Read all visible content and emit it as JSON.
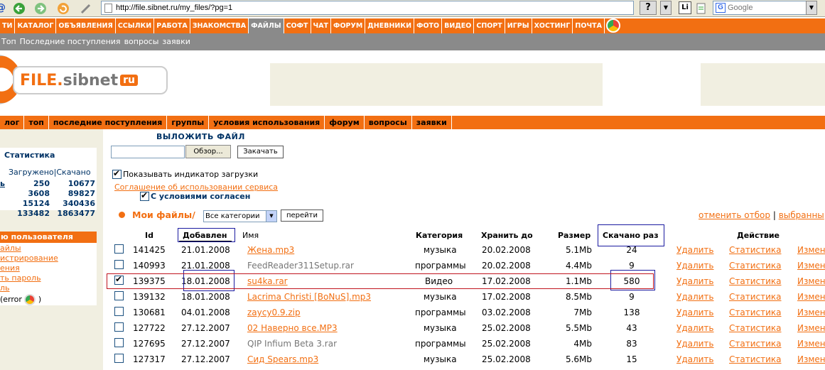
{
  "browser": {
    "url": "http://file.sibnet.ru/my_files/?pg=1",
    "help_label": "?",
    "search_placeholder": "Google",
    "li_label": "Li"
  },
  "top_nav": [
    "ТИ",
    "КАТАЛОГ",
    "ОБЪЯВЛЕНИЯ",
    "ССЫЛКИ",
    "РАБОТА",
    "ЗНАКОМСТВА",
    "ФАЙЛЫ",
    "СОФТ",
    "ЧАТ",
    "ФОРУМ",
    "ДНЕВНИКИ",
    "ФОТО",
    "ВИДЕО",
    "СПОРТ",
    "ИГРЫ",
    "ХОСТИНГ",
    "ПОЧТА"
  ],
  "top_nav_active": "ФАЙЛЫ",
  "sub_nav": [
    "Топ",
    "Последние поступления",
    "вопросы",
    "заявки"
  ],
  "logo": {
    "main": "FILE.",
    "brand": "sibnet",
    "tld": "ru"
  },
  "sec_nav": [
    "лог",
    "топ",
    "последние поступления",
    "группы",
    "условия использования",
    "форум",
    "вопросы",
    "заявки"
  ],
  "sidebar": {
    "stats_title": "Статистика",
    "stats_header": "Загружено|Скачано",
    "stats_rows": [
      {
        "prefix": "ь",
        "uploaded": "250",
        "downloaded": "10677"
      },
      {
        "prefix": "",
        "uploaded": "3608",
        "downloaded": "89827"
      },
      {
        "prefix": "",
        "uploaded": "15124",
        "downloaded": "340436"
      },
      {
        "prefix": "",
        "uploaded": "133482",
        "downloaded": "1863477"
      }
    ],
    "user_menu_title": "ю пользователя",
    "user_links": [
      "айлы",
      "истрирование",
      "ения",
      "ть пароль",
      "ль"
    ],
    "error_label": "(error",
    "error_suffix": ")"
  },
  "upload": {
    "title": "ВЫЛОЖИТЬ ФАЙЛ",
    "browse_label": "Обзор...",
    "upload_label": "Закачать",
    "show_progress_label": "Показывать индикатор загрузки",
    "terms_link": "Соглашение об использовании сервиса",
    "agree_label": "С условиями согласен"
  },
  "myfiles": {
    "title": "Мои файлы/",
    "category_selected": "Все категории",
    "go_label": "перейти",
    "cancel_selection": "отменить отбор",
    "separator": "|",
    "selected_link": "выбранны"
  },
  "table": {
    "headers": {
      "id": "Id",
      "added": "Добавлен",
      "name": "Имя",
      "category": "Категория",
      "keep_until": "Хранить до",
      "size": "Размер",
      "downloads": "Скачано раз",
      "action": "Действие"
    },
    "actions": {
      "delete": "Удалить",
      "stats": "Статистика",
      "edit": "Измен"
    },
    "rows": [
      {
        "checked": false,
        "id": "141425",
        "added": "21.01.2008",
        "name": "Жена.mp3",
        "name_link": true,
        "category": "музыка",
        "keep_until": "20.02.2008",
        "size": "5.1Mb",
        "downloads": "24"
      },
      {
        "checked": false,
        "id": "140993",
        "added": "21.01.2008",
        "name": "FeedReader311Setup.rar",
        "name_link": false,
        "category": "программы",
        "keep_until": "20.02.2008",
        "size": "4.4Mb",
        "downloads": "9"
      },
      {
        "checked": true,
        "id": "139375",
        "added": "18.01.2008",
        "name": "su4ka.rar",
        "name_link": true,
        "category": "Видео",
        "keep_until": "17.02.2008",
        "size": "1.1Mb",
        "downloads": "580"
      },
      {
        "checked": false,
        "id": "139132",
        "added": "18.01.2008",
        "name": "Lacrima Christi [BoNuS].mp3",
        "name_link": true,
        "category": "музыка",
        "keep_until": "17.02.2008",
        "size": "8.5Mb",
        "downloads": "9"
      },
      {
        "checked": false,
        "id": "130681",
        "added": "04.01.2008",
        "name": "zaycy0.9.zip",
        "name_link": true,
        "category": "программы",
        "keep_until": "03.02.2008",
        "size": "7Mb",
        "downloads": "138"
      },
      {
        "checked": false,
        "id": "127722",
        "added": "27.12.2007",
        "name": "02 Наверно все.MP3",
        "name_link": true,
        "category": "музыка",
        "keep_until": "25.02.2008",
        "size": "5.5Mb",
        "downloads": "43"
      },
      {
        "checked": false,
        "id": "127695",
        "added": "27.12.2007",
        "name": "QIP Infium Beta 3.rar",
        "name_link": false,
        "category": "программы",
        "keep_until": "25.02.2008",
        "size": "4Mb",
        "downloads": "83"
      },
      {
        "checked": false,
        "id": "127317",
        "added": "27.12.2007",
        "name": "Сид Spears.mp3",
        "name_link": true,
        "category": "музыка",
        "keep_until": "25.02.2008",
        "size": "5.6Mb",
        "downloads": "15"
      }
    ]
  },
  "colors": {
    "orange": "#f26f12",
    "gray_nav": "#8a8a8a",
    "navy": "#003366",
    "annotation_blue": "#1a1aa0",
    "annotation_red": "#c0141e"
  }
}
